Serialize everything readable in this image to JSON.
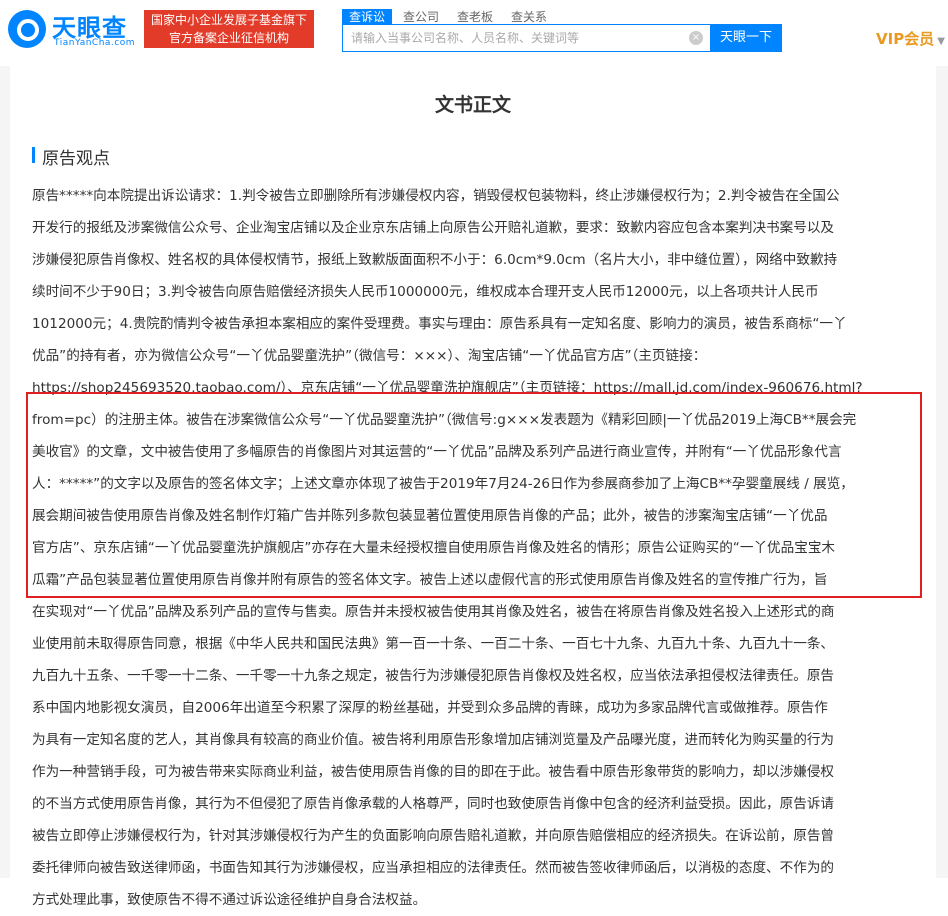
{
  "header": {
    "logo_cn": "天眼查",
    "logo_en": "TianYanCha.com",
    "badge_line1": "国家中小企业发展子基金旗下",
    "badge_line2": "官方备案企业征信机构",
    "tabs": [
      {
        "label": "查诉讼"
      },
      {
        "label": "查公司"
      },
      {
        "label": "查老板"
      },
      {
        "label": "查关系"
      }
    ],
    "search_placeholder": "请输入当事公司名称、人员名称、关键词等",
    "search_button": "天眼一下",
    "vip_label": "VIP会员",
    "accent_color": "#0084ff",
    "badge_color": "#e33b2a"
  },
  "document": {
    "title": "文书正文",
    "section_title": "原告观点",
    "lines": [
      "原告*****向本院提出诉讼请求：1.判令被告立即删除所有涉嫌侵权内容，销毁侵权包装物料，终止涉嫌侵权行为；2.判令被告在全国公",
      "开发行的报纸及涉案微信公众号、企业淘宝店铺以及企业京东店铺上向原告公开赔礼道歉，要求：致歉内容应包含本案判决书案号以及",
      "涉嫌侵犯原告肖像权、姓名权的具体侵权情节，报纸上致歉版面面积不小于：6.0cm*9.0cm（名片大小，非中缝位置），网络中致歉持",
      "续时间不少于90日；3.判令被告向原告赔偿经济损失人民币1000000元，维权成本合理开支人民币12000元，以上各项共计人民币",
      "1012000元；4.贵院酌情判令被告承担本案相应的案件受理费。事实与理由：原告系具有一定知名度、影响力的演员，被告系商标“一丫",
      "优品”的持有者，亦为微信公众号“一丫优品婴童洗护”（微信号：×××）、淘宝店铺“一丫优品官方店”（主页链接：",
      "https://shop245693520.taobao.com/）、京东店铺“一丫优品婴童洗护旗舰店”（主页链接：https://mall.jd.com/index-960676.html?",
      "from=pc）的注册主体。被告在涉案微信公众号“一丫优品婴童洗护”（微信号:g×××发表题为《精彩回顾|一丫优品2019上海CB**展会完",
      "美收官》的文章，文中被告使用了多幅原告的肖像图片对其运营的“一丫优品”品牌及系列产品进行商业宣传，并附有“一丫优品形象代言",
      "人：*****”的文字以及原告的签名体文字；上述文章亦体现了被告于2019年7月24-26日作为参展商参加了上海CB**孕婴童展线 / 展览，",
      "展会期间被告使用原告肖像及姓名制作灯箱广告并陈列多款包装显著位置使用原告肖像的产品；此外，被告的涉案淘宝店铺“一丫优品",
      "官方店”、京东店铺“一丫优品婴童洗护旗舰店”亦存在大量未经授权擅自使用原告肖像及姓名的情形；原告公证购买的“一丫优品宝宝木",
      "瓜霜”产品包装显著位置使用原告肖像并附有原告的签名体文字。被告上述以虚假代言的形式使用原告肖像及姓名的宣传推广行为，旨",
      "在实现对“一丫优品”品牌及系列产品的宣传与售卖。原告并未授权被告使用其肖像及姓名，被告在将原告肖像及姓名投入上述形式的商",
      "业使用前未取得原告同意，根据《中华人民共和国民法典》第一百一十条、一百二十条、一百七十九条、九百九十条、九百九十一条、",
      "九百九十五条、一千零一十二条、一千零一十九条之规定，被告行为涉嫌侵犯原告肖像权及姓名权，应当依法承担侵权法律责任。原告",
      "系中国内地影视女演员，自2006年出道至今积累了深厚的粉丝基础，并受到众多品牌的青睐，成功为多家品牌代言或做推荐。原告作",
      "为具有一定知名度的艺人，其肖像具有较高的商业价值。被告将利用原告形象增加店铺浏览量及产品曝光度，进而转化为购买量的行为",
      "作为一种营销手段，可为被告带来实际商业利益，被告使用原告肖像的目的即在于此。被告看中原告形象带货的影响力，却以涉嫌侵权",
      "的不当方式使用原告肖像，其行为不但侵犯了原告肖像承载的人格尊严，同时也致使原告肖像中包含的经济利益受损。因此，原告诉请",
      "被告立即停止涉嫌侵权行为，针对其涉嫌侵权行为产生的负面影响向原告赔礼道歉，并向原告赔偿相应的经济损失。在诉讼前，原告曾",
      "委托律师向被告致送律师函，书面告知其行为涉嫌侵权，应当承担相应的法律责任。然而被告签收律师函后，以消极的态度、不作为的",
      "方式处理此事，致使原告不得不通过诉讼途径维护自身合法权益。"
    ],
    "highlight_color": "#e02020"
  }
}
